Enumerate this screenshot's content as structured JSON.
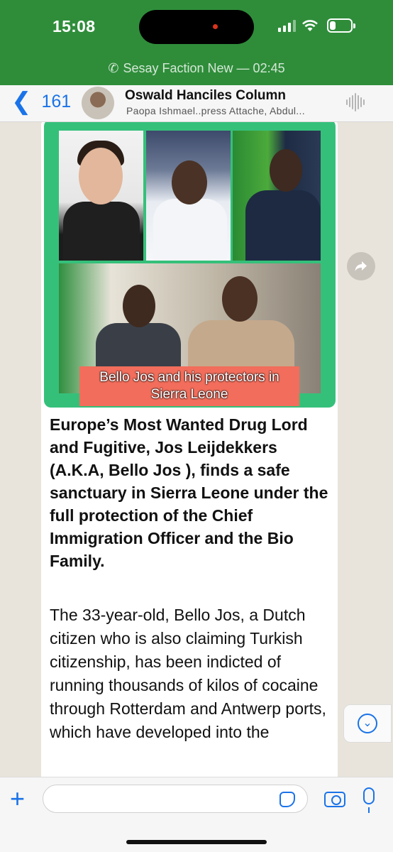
{
  "status_bar": {
    "time": "15:08",
    "battery_level": 0.3
  },
  "call_banner": {
    "text": "Sesay Faction New — 02:45",
    "icon": "phone-icon"
  },
  "chat_header": {
    "back_count": "161",
    "title": "Oswald Hanciles Column",
    "subtitle": "Paopa Ishmael..press Attache, Abdul..."
  },
  "message": {
    "image_caption": "Bello Jos and his protectors in Sierra Leone",
    "headline": "Europe’s Most Wanted Drug Lord and Fugitive, Jos Leijdekkers (A.K.A, Bello Jos ), finds a safe sanctuary in Sierra Leone under the full protection of the Chief Immigration Officer and the Bio Family.",
    "body": "The 33-year-old,  Bello Jos, a Dutch citizen who is also claiming Turkish citizenship, has been indicted of running thousands of kilos of cocaine through Rotterdam and Antwerp ports, which have developed into the"
  },
  "input_bar": {
    "placeholder": ""
  },
  "colors": {
    "header_green": "#2f8d3a",
    "accent_blue": "#1a73e8",
    "image_frame": "#35c07a",
    "caption_bg": "#f26d5b"
  }
}
